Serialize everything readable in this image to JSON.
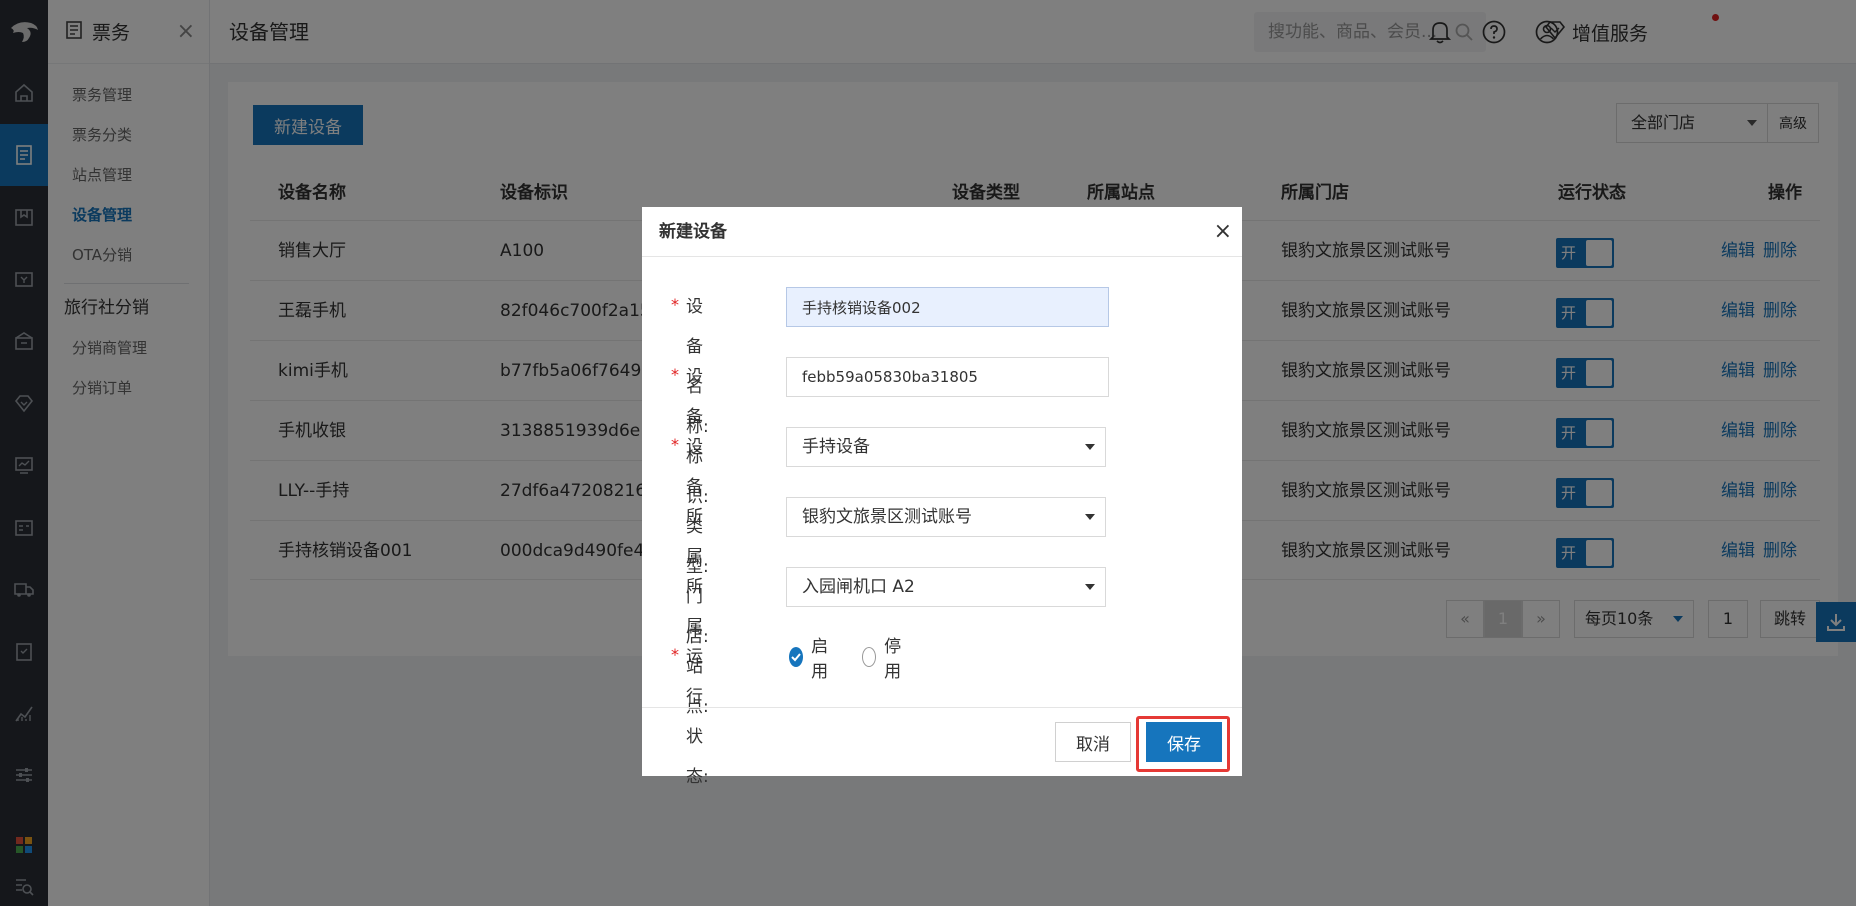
{
  "app": {
    "section_title": "票务",
    "close_glyph": "×"
  },
  "rail": {
    "icons": [
      "logo-icon",
      "home-icon",
      "ticket-icon",
      "book-icon",
      "wallet-icon",
      "gift-icon",
      "diamond-icon",
      "monitor-icon",
      "id-card-icon",
      "truck-icon",
      "clipboard-icon",
      "chart-icon",
      "sliders-icon",
      "apps-icon",
      "search-list-icon"
    ],
    "active_color": "#1675bd"
  },
  "subnav": {
    "items": [
      "票务管理",
      "票务分类",
      "站点管理",
      "设备管理",
      "OTA分销"
    ],
    "active_item": "设备管理",
    "group_title": "旅行社分销",
    "group_items": [
      "分销商管理",
      "分销订单"
    ]
  },
  "topbar": {
    "page_title": "设备管理",
    "search_placeholder": "搜功能、商品、会员...",
    "value_added": "增值服务"
  },
  "toolbar": {
    "new_device": "新建设备",
    "store_filter": "全部门店",
    "advanced": "高级"
  },
  "table": {
    "headers": {
      "name": "设备名称",
      "id": "设备标识",
      "type": "设备类型",
      "site": "所属站点",
      "store": "所属门店",
      "status": "运行状态",
      "ops": "操作"
    },
    "rows": [
      {
        "name": "销售大厅",
        "id": "A100",
        "store": "银豹文旅景区测试账号",
        "toggle": "开"
      },
      {
        "name": "王磊手机",
        "id": "82f046c700f2a15c",
        "store": "银豹文旅景区测试账号",
        "toggle": "开"
      },
      {
        "name": "kimi手机",
        "id": "b77fb5a06f7649dc",
        "store": "银豹文旅景区测试账号",
        "toggle": "开"
      },
      {
        "name": "手机收银",
        "id": "3138851939d6e13",
        "store": "银豹文旅景区测试账号",
        "toggle": "开"
      },
      {
        "name": "LLY--手持",
        "id": "27df6a47208216d",
        "store": "银豹文旅景区测试账号",
        "toggle": "开"
      },
      {
        "name": "手持核销设备001",
        "id": "000dca9d490fe41",
        "store": "银豹文旅景区测试账号",
        "toggle": "开"
      }
    ],
    "edit": "编辑",
    "delete": "删除"
  },
  "pagination": {
    "prev": "«",
    "current": "1",
    "next": "»",
    "page_size": "每页10条",
    "jump_value": "1",
    "jump": "跳转"
  },
  "modal": {
    "title": "新建设备",
    "close": "×",
    "name_label": "设备名称:",
    "name_value": "手持核销设备002",
    "id_label": "设备标识:",
    "id_value": "febb59a05830ba31805",
    "type_label": "设备类型:",
    "type_value": "手持设备",
    "store_label": "所属门店:",
    "store_value": "银豹文旅景区测试账号",
    "site_label": "所属站点:",
    "site_value": "入园闸机口 A2",
    "status_label": "运行状态:",
    "status_on": "启用",
    "status_off": "停用",
    "cancel": "取消",
    "save": "保存"
  },
  "colors": {
    "primary": "#1675bd",
    "danger": "#e53935",
    "rail": "#2b2f36"
  }
}
